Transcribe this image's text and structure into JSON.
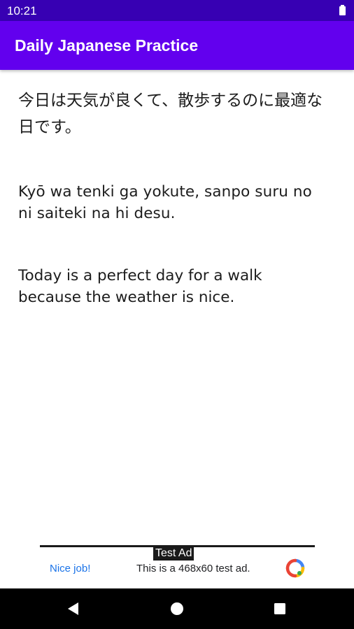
{
  "status_bar": {
    "time": "10:21",
    "battery_icon": "battery-full-icon"
  },
  "app_bar": {
    "title": "Daily Japanese Practice",
    "color": "#6200ee",
    "status_color": "#3700b3"
  },
  "lesson": {
    "japanese": "今日は天気が良くて、散歩するのに最適な日です。",
    "romaji": "Kyō wa tenki ga yokute, sanpo suru no ni saiteki na hi desu.",
    "english": "Today is a perfect day for a walk because the weather is nice."
  },
  "ad": {
    "label": "Test Ad",
    "cta": "Nice job!",
    "text": "This is a 468x60 test ad.",
    "icon": "adchoices-logo-icon"
  },
  "nav": {
    "back_icon": "back-triangle-icon",
    "home_icon": "home-circle-icon",
    "recents_icon": "recents-square-icon"
  }
}
